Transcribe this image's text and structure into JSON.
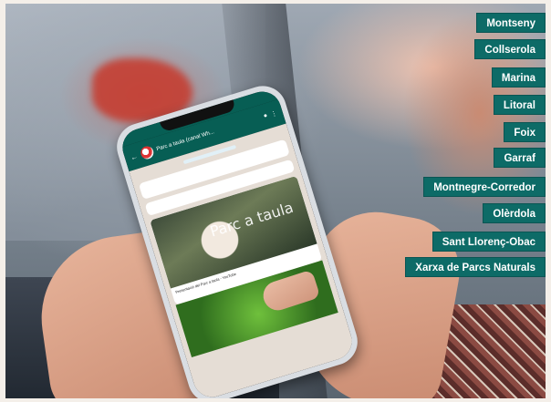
{
  "park_links": [
    {
      "label": "Montseny"
    },
    {
      "label": "Collserola"
    },
    {
      "label": "Marina"
    },
    {
      "label": "Litoral"
    },
    {
      "label": "Foix"
    },
    {
      "label": "Garraf"
    },
    {
      "label": "Montnegre-Corredor"
    },
    {
      "label": "Olèrdola"
    },
    {
      "label": "Sant Llorenç-Obac"
    },
    {
      "label": "Xarxa de Parcs Naturals"
    }
  ],
  "phone": {
    "chat_title": "Parc a taula (canal Wh...",
    "media_overlay_text": "Parc a taula",
    "media_caption": "Presentació del Parc a taula - YouTube"
  },
  "colors": {
    "tag_background": "#0d6b67",
    "tag_text": "#ffffff"
  }
}
